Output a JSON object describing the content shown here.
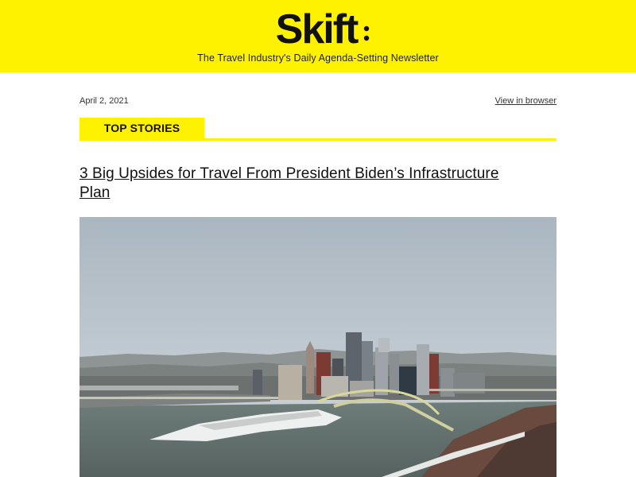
{
  "header": {
    "logo_text": "Skift",
    "tagline": "The Travel Industry's Daily Agenda-Setting Newsletter",
    "background_color": "#fff200"
  },
  "meta": {
    "date": "April 2, 2021",
    "view_in_browser": "View in browser"
  },
  "section": {
    "label": "TOP STORIES",
    "accent_color": "#fff200"
  },
  "story": {
    "headline": "3 Big Upsides for Travel From President Biden’s Infrastructure Plan",
    "image_subject": "city-skyline-river-aerial-photo"
  }
}
